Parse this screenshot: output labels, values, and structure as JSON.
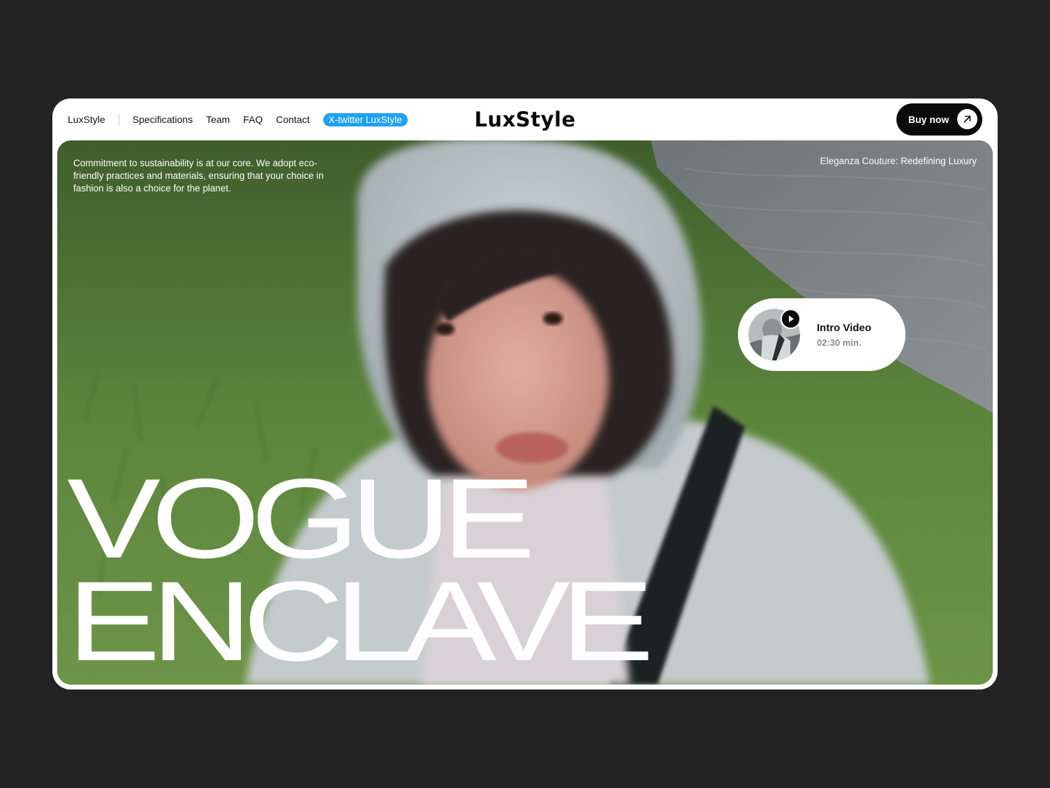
{
  "nav": {
    "brand": "LuxStyle",
    "links": [
      "Specifications",
      "Team",
      "FAQ",
      "Contact"
    ],
    "twitter": "X-twitter LuxStyle"
  },
  "logo": "LuxStyle",
  "buy": {
    "label": "Buy now",
    "icon": "arrow-up-right-icon"
  },
  "hero": {
    "copy": "Commitment to sustainability is at our core. We adopt eco-friendly practices and materials, ensuring that your choice in fashion is also a choice for the planet.",
    "tagline": "Eleganza Couture: Redefining Luxury",
    "headline": [
      "VOGUE",
      "ENCLAVE"
    ]
  },
  "video": {
    "title": "Intro Video",
    "duration": "02:30 min.",
    "icon": "play-icon"
  },
  "colors": {
    "background": "#232323",
    "accent_twitter": "#1da1f2",
    "button": "#0b0b0b"
  }
}
